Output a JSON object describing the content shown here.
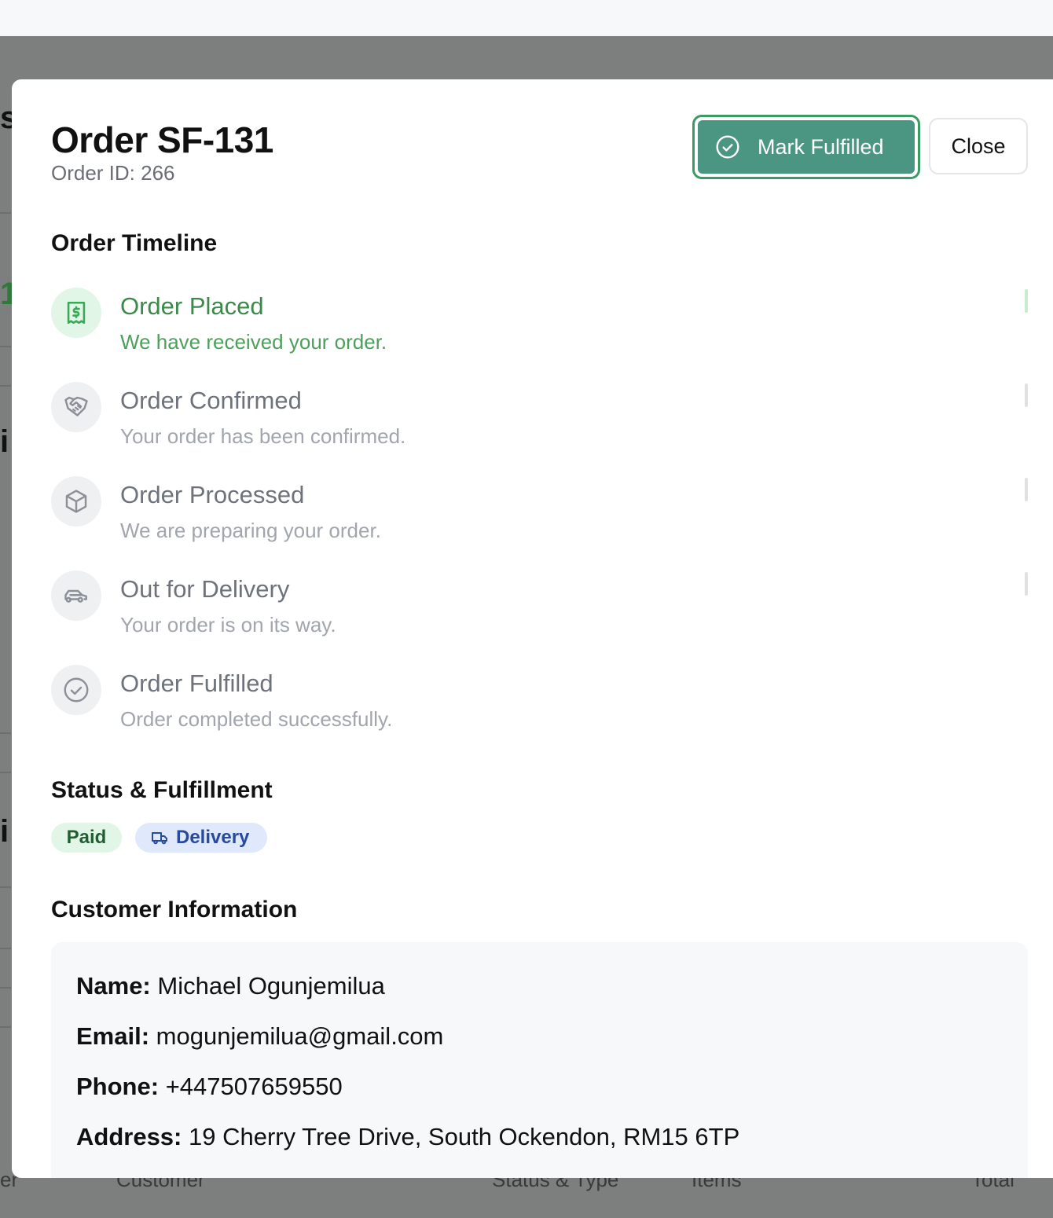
{
  "modal": {
    "title": "Order SF-131",
    "subtitle": "Order ID: 266",
    "actions": {
      "fulfill_label": "Mark Fulfilled",
      "close_label": "Close"
    }
  },
  "timeline": {
    "heading": "Order Timeline",
    "steps": [
      {
        "title": "Order Placed",
        "description": "We have received your order.",
        "icon": "receipt-icon",
        "state": "active"
      },
      {
        "title": "Order Confirmed",
        "description": "Your order has been confirmed.",
        "icon": "handshake-icon",
        "state": "pending"
      },
      {
        "title": "Order Processed",
        "description": "We are preparing your order.",
        "icon": "box-icon",
        "state": "pending"
      },
      {
        "title": "Out for Delivery",
        "description": "Your order is on its way.",
        "icon": "car-icon",
        "state": "pending"
      },
      {
        "title": "Order Fulfilled",
        "description": "Order completed successfully.",
        "icon": "check-circle-icon",
        "state": "pending"
      }
    ]
  },
  "status": {
    "heading": "Status & Fulfillment",
    "payment_badge": "Paid",
    "fulfillment_badge": "Delivery"
  },
  "customer": {
    "heading": "Customer Information",
    "name_label": "Name:",
    "name": "Michael Ogunjemilua",
    "email_label": "Email:",
    "email": "mogunjemilua@gmail.com",
    "phone_label": "Phone:",
    "phone": "+447507659550",
    "address_label": "Address:",
    "address": "19 Cherry Tree Drive, South Ockendon, RM15 6TP"
  },
  "background_table": {
    "columns": [
      "er",
      "Customer",
      "Status & Type",
      "Items",
      "Total"
    ]
  },
  "colors": {
    "accent": "#4b9583",
    "accent_border": "#3a9c63",
    "active_step": "#3a8a4a",
    "paid_bg": "#e2f6e7",
    "delivery_bg": "#dfe9fb"
  }
}
